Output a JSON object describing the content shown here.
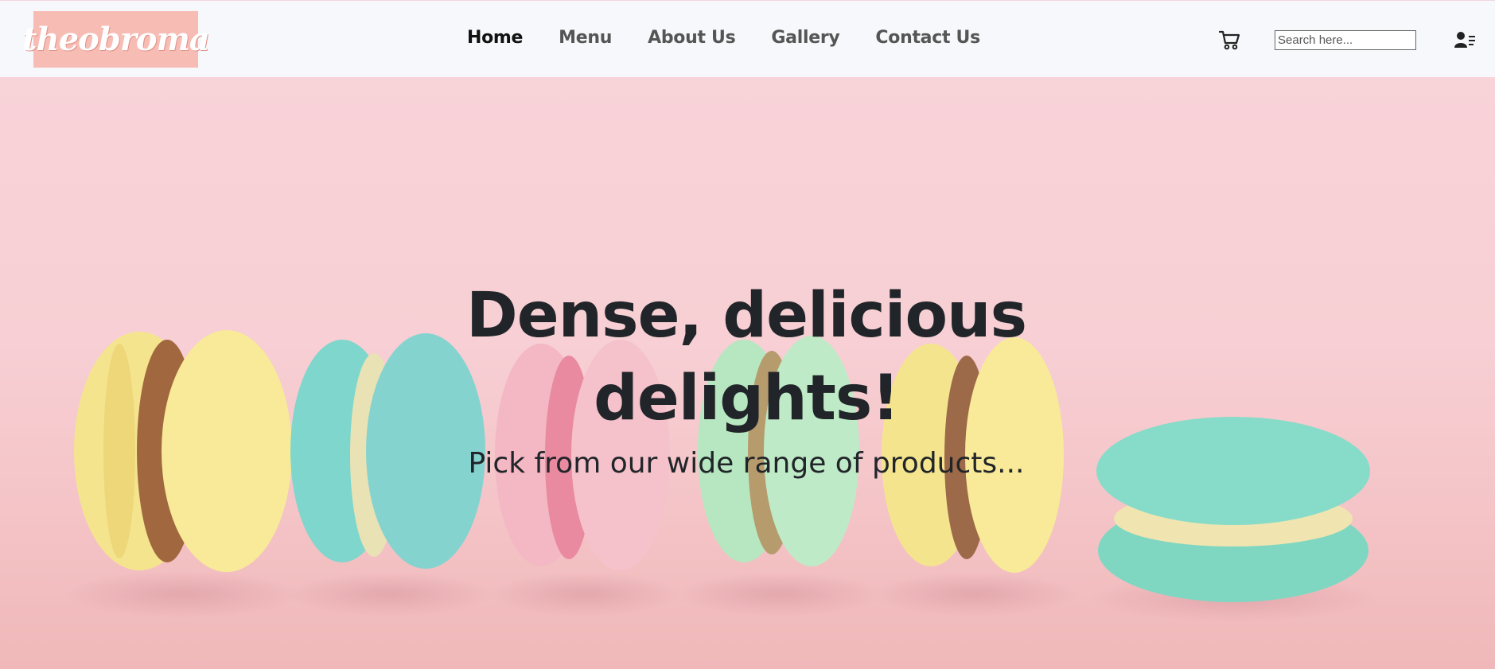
{
  "brand": {
    "logo_text": "theobroma",
    "logo_bg": "#f7bcb4"
  },
  "nav": {
    "items": [
      {
        "label": "Home",
        "active": true
      },
      {
        "label": "Menu",
        "active": false
      },
      {
        "label": "About Us",
        "active": false
      },
      {
        "label": "Gallery",
        "active": false
      },
      {
        "label": "Contact Us",
        "active": false
      }
    ]
  },
  "header_actions": {
    "cart_icon": "shopping-cart",
    "search_placeholder": "Search here...",
    "user_icon": "user-list"
  },
  "hero": {
    "headline": "Dense, delicious delights!",
    "subline": "Pick from our wide range of products...",
    "background": "pastel macarons on pink background"
  },
  "colors": {
    "header_bg": "#f7f8fb",
    "hero_pink": "#f7cfd4",
    "text_dark": "#212529",
    "nav_text": "#555555"
  }
}
